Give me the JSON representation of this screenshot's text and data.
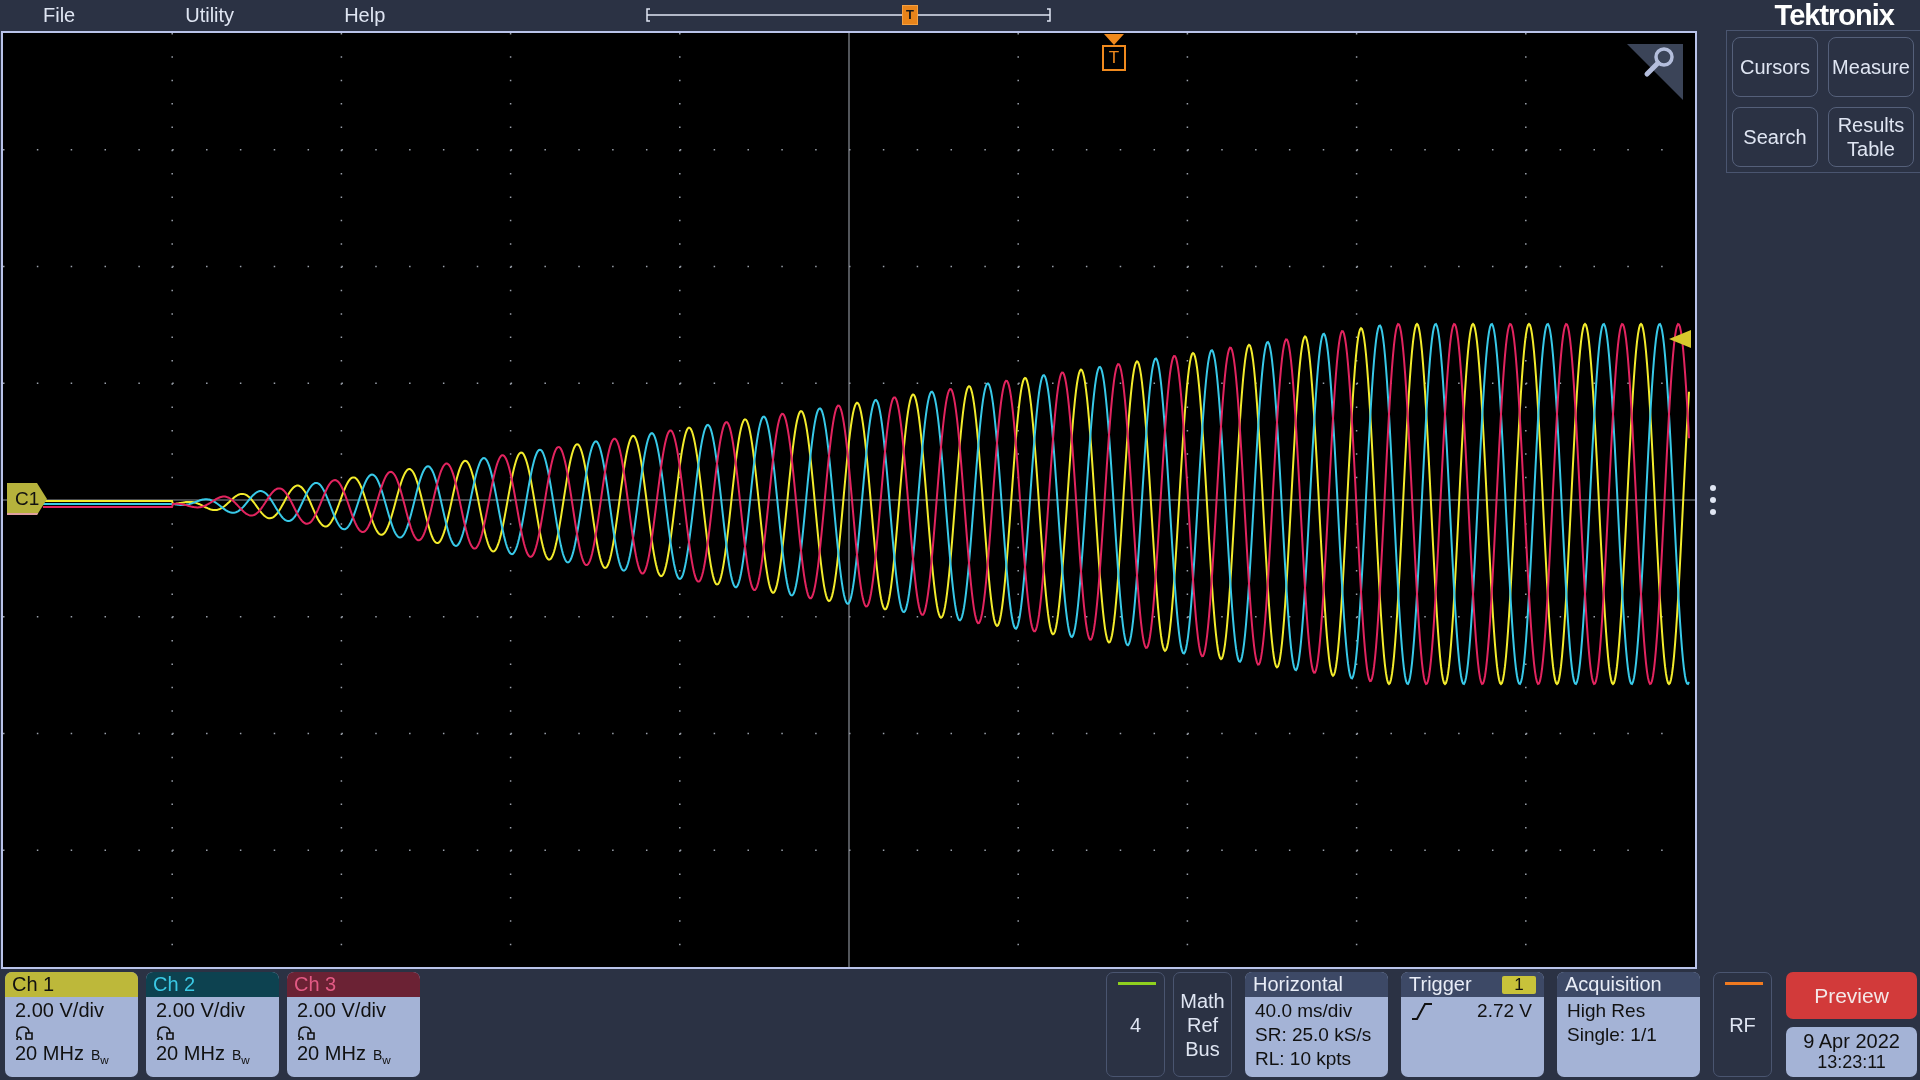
{
  "menu": [
    {
      "label": "File"
    },
    {
      "label": "Utility"
    },
    {
      "label": "Help"
    }
  ],
  "overview": {
    "trigger_marker": "T"
  },
  "logo": "Tektronix",
  "display": {
    "channel_marker": "C1",
    "trigger_marker": "T"
  },
  "side_buttons": [
    {
      "lines": [
        "Cursors"
      ]
    },
    {
      "lines": [
        "Measure"
      ]
    },
    {
      "lines": [
        "Search"
      ]
    },
    {
      "lines": [
        "Results",
        "Table"
      ]
    }
  ],
  "channels": [
    {
      "label": "Ch 1",
      "scale": "2.00 V/div",
      "bandwidth": "20 MHz",
      "bw_mark": "B$_{w}$",
      "color": "#bdb83a"
    },
    {
      "label": "Ch 2",
      "scale": "2.00 V/div",
      "bandwidth": "20 MHz",
      "bw_mark": "B$_{w}$",
      "color": "#0d4250"
    },
    {
      "label": "Ch 3",
      "scale": "2.00 V/div",
      "bandwidth": "20 MHz",
      "bw_mark": "B$_{w}$",
      "color": "#6b2234"
    }
  ],
  "add_channel": "4",
  "math_ref_bus": [
    "Math",
    "Ref",
    "Bus"
  ],
  "horizontal": {
    "title": "Horizontal",
    "lines": [
      "40.0 ms/div",
      "SR: 25.0 kS/s",
      "RL: 10 kpts"
    ]
  },
  "trigger": {
    "title": "Trigger",
    "source": "1",
    "level": "2.72 V"
  },
  "acquisition": {
    "title": "Acquisition",
    "lines": [
      "High Res",
      "Single: 1/1"
    ]
  },
  "rf": "RF",
  "preview": "Preview",
  "date": "9 Apr 2022",
  "time": "13:23:11"
}
